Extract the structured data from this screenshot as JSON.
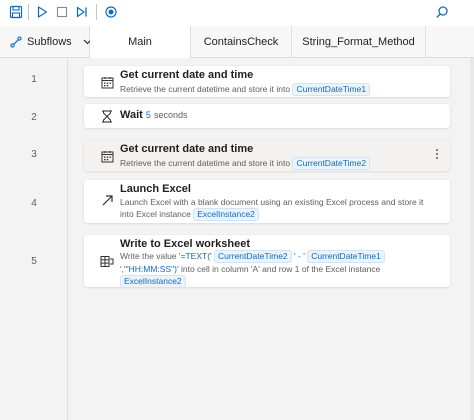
{
  "toolbar": {
    "icons": [
      "save-icon",
      "run-icon",
      "stop-icon",
      "run-next-action-icon",
      "record-icon",
      "search-icon"
    ]
  },
  "tabs": {
    "subflows_label": "Subflows",
    "items": [
      {
        "label": "Main",
        "active": true
      },
      {
        "label": "ContainsCheck",
        "active": false
      },
      {
        "label": "String_Format_Method",
        "active": false
      }
    ]
  },
  "steps": [
    {
      "line": "1",
      "title": "Get current date and time",
      "desc_prefix": "Retrieve the current datetime and store it into",
      "var": "CurrentDateTime1"
    },
    {
      "line": "2",
      "title": "Wait",
      "wait_value": "5",
      "wait_unit": "seconds"
    },
    {
      "line": "3",
      "title": "Get current date and time",
      "desc_prefix": "Retrieve the current datetime and store it into",
      "var": "CurrentDateTime2"
    },
    {
      "line": "4",
      "title": "Launch Excel",
      "desc_line1": "Launch Excel with a blank document using an existing Excel process and store it",
      "desc_line2_prefix": "into Excel instance",
      "var": "ExcelInstance2"
    },
    {
      "line": "5",
      "title": "Write to Excel worksheet",
      "desc_a": "Write the value '",
      "desc_b": "=TEXT('",
      "var1": "CurrentDateTime2",
      "desc_c": "' - '",
      "var2": "CurrentDateTime1",
      "desc_d": "','\"HH:MM:SS\")'",
      "desc_e": "into cell in column 'A' and row 1 of the Excel instance",
      "var3": "ExcelInstance2"
    }
  ],
  "colors": {
    "accent": "#0f6cbd",
    "var_bg": "#ebf3fc"
  }
}
